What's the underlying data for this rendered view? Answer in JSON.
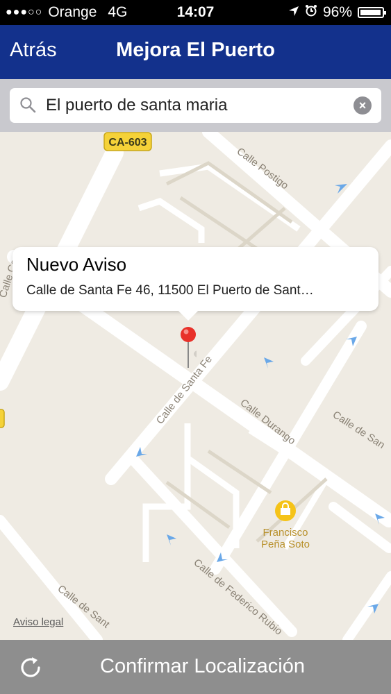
{
  "status_bar": {
    "carrier": "Orange",
    "network": "4G",
    "time": "14:07",
    "battery": "96%",
    "battery_level": 0.96,
    "signal_bars_filled": 3
  },
  "nav": {
    "back_label": "Atrás",
    "title": "Mejora El Puerto"
  },
  "search": {
    "value": "El puerto de santa maria"
  },
  "map": {
    "road_badge": "CA-603",
    "streets": {
      "postigo": "Calle Postigo",
      "santa_fe": "Calle de Santa Fe",
      "durango": "Calle Durango",
      "calle_de_san": "Calle de San",
      "federico": "Calle de Federico Rubio",
      "calle_de_santa_bottom": "Calle de Sant",
      "calle_left": "Calle Cau"
    },
    "poi": {
      "name_line1": "Francisco",
      "name_line2": "Peña Soto"
    },
    "legal": "Aviso legal"
  },
  "callout": {
    "title": "Nuevo Aviso",
    "address": "Calle de Santa Fe 46, 11500 El Puerto de Sant…"
  },
  "bottom": {
    "confirm_label": "Confirmar Localización"
  },
  "colors": {
    "nav_bg": "#13318c",
    "search_bg": "#c9c9ce",
    "map_bg": "#efebe3",
    "pin": "#e8312a",
    "bottom_bg": "#8e8e8e"
  }
}
